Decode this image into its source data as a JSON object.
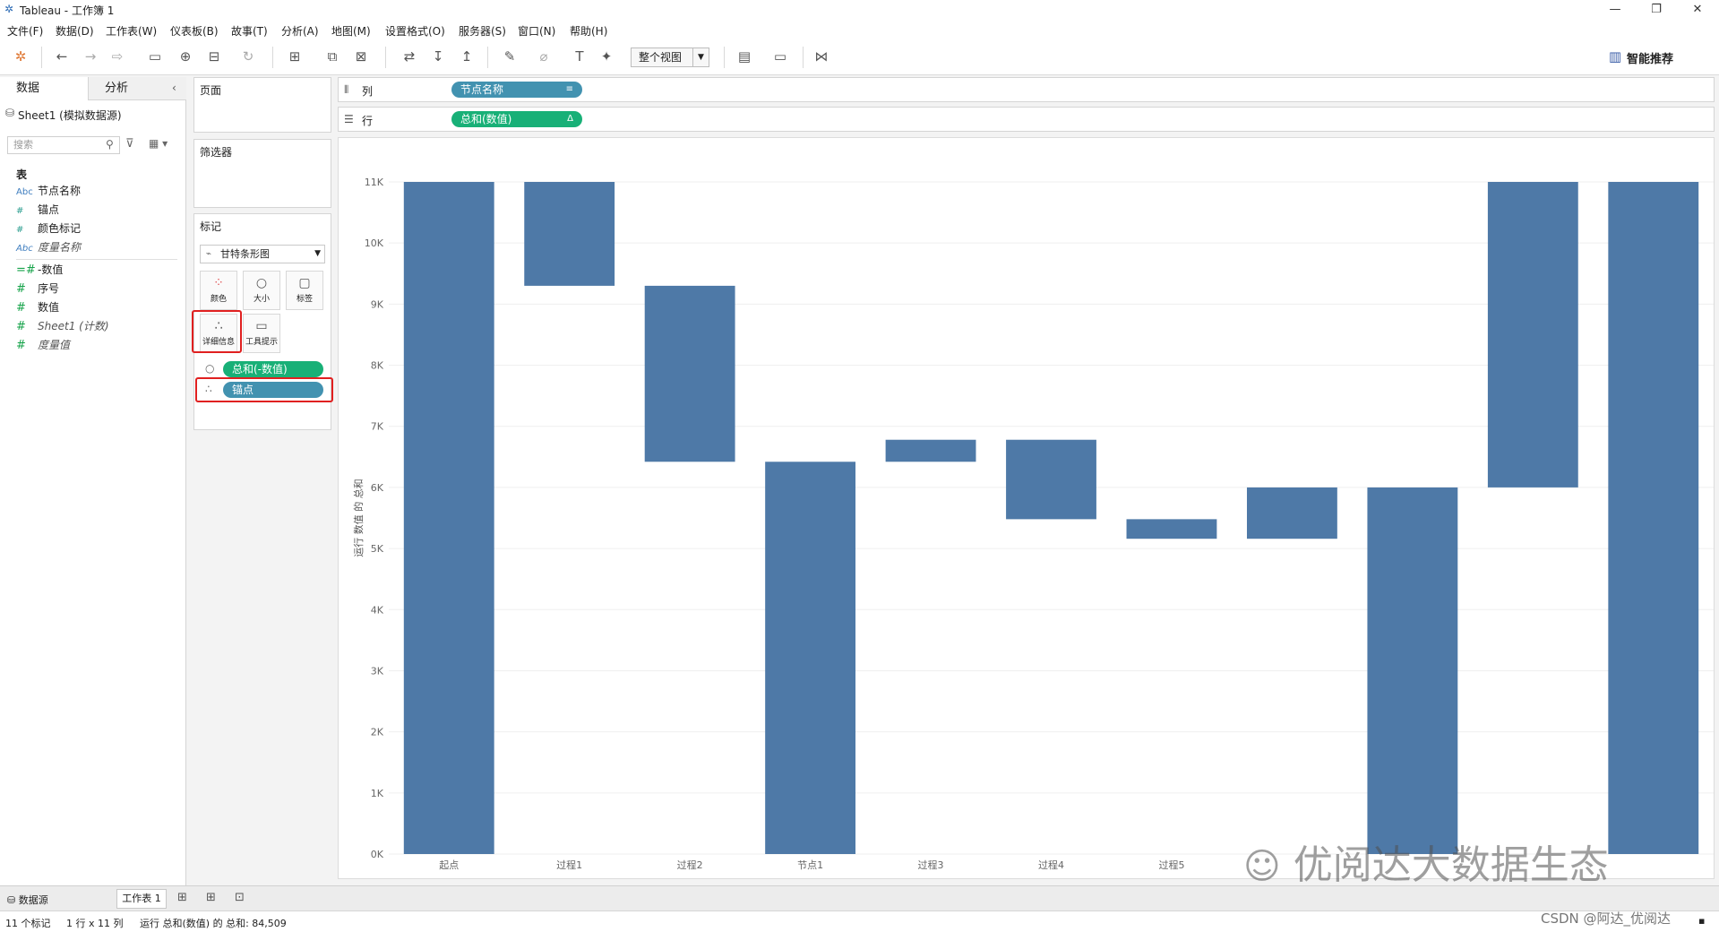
{
  "window": {
    "title": "Tableau - 工作簿 1"
  },
  "menu": [
    "文件(F)",
    "数据(D)",
    "工作表(W)",
    "仪表板(B)",
    "故事(T)",
    "分析(A)",
    "地图(M)",
    "设置格式(O)",
    "服务器(S)",
    "窗口(N)",
    "帮助(H)"
  ],
  "toolbar": {
    "fit_view": "整个视图",
    "smart_recommend": "智能推荐"
  },
  "data_pane": {
    "tab_data": "数据",
    "tab_analysis": "分析",
    "source": "Sheet1 (模拟数据源)",
    "search_placeholder": "搜索",
    "table_header": "表",
    "fields": [
      {
        "type": "Abc",
        "name": "节点名称"
      },
      {
        "type": "#",
        "name": "锚点"
      },
      {
        "type": "#",
        "name": "颜色标记"
      },
      {
        "type": "Abc",
        "name": "度量名称"
      },
      {
        "type": "=#",
        "name": "-数值"
      },
      {
        "type": "#",
        "name": "序号"
      },
      {
        "type": "#",
        "name": "数值"
      },
      {
        "type": "#",
        "name": "Sheet1 (计数)"
      },
      {
        "type": "#",
        "name": "度量值"
      }
    ]
  },
  "shelves": {
    "pages": "页面",
    "filters": "筛选器",
    "marks": "标记",
    "mark_type": "甘特条形图",
    "buttons": {
      "color": "颜色",
      "size": "大小",
      "label": "标签",
      "detail": "详细信息",
      "tooltip": "工具提示"
    },
    "pill_size": "总和(-数值)",
    "pill_detail": "锚点",
    "columns_label": "列",
    "rows_label": "行",
    "columns_pill": "节点名称",
    "rows_pill": "总和(数值)"
  },
  "chart_data": {
    "type": "bar",
    "subtype": "gantt-waterfall",
    "categories": [
      "起点",
      "过程1",
      "过程2",
      "节点1",
      "过程3",
      "过程4",
      "过程5",
      "",
      "",
      ""
    ],
    "bars": [
      {
        "category": "起点",
        "low": 0,
        "high": 11000
      },
      {
        "category": "过程1",
        "low": 9300,
        "high": 11000
      },
      {
        "category": "过程2",
        "low": 6420,
        "high": 9300
      },
      {
        "category": "节点1",
        "low": 0,
        "high": 6420
      },
      {
        "category": "过程3",
        "low": 6420,
        "high": 6780
      },
      {
        "category": "过程4",
        "low": 5480,
        "high": 6780
      },
      {
        "category": "过程5",
        "low": 5160,
        "high": 5480
      },
      {
        "category": "",
        "low": 5160,
        "high": 6000
      },
      {
        "category": "",
        "low": 0,
        "high": 6000
      },
      {
        "category": "",
        "low": 6000,
        "high": 11000
      },
      {
        "category": "",
        "low": 0,
        "high": 11000
      }
    ],
    "yticks": [
      "0K",
      "1K",
      "2K",
      "3K",
      "4K",
      "5K",
      "6K",
      "7K",
      "8K",
      "9K",
      "10K",
      "11K"
    ],
    "ylim": [
      0,
      11000
    ],
    "ylabel": "运行 数值 的 总和",
    "bar_color": "#4e79a7",
    "grid": true
  },
  "sheet_tabs": {
    "datasource": "数据源",
    "sheet": "工作表 1"
  },
  "status": {
    "marks": "11 个标记",
    "dims": "1 行 x 11 列",
    "sum": "运行 总和(数值) 的 总和: 84,509"
  },
  "watermark": {
    "text": "优阅达大数据生态",
    "csdn": "CSDN @阿达_优阅达"
  }
}
